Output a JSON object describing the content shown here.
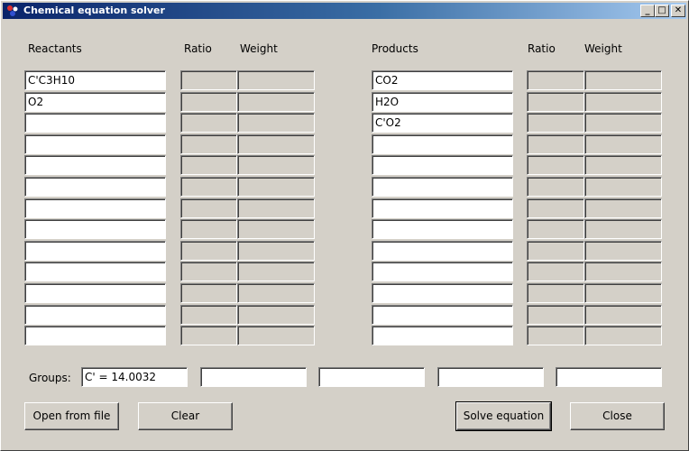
{
  "window": {
    "title": "Chemical equation solver",
    "minimize_glyph": "_",
    "maximize_glyph": "□",
    "close_glyph": "✕"
  },
  "columns": {
    "reactants": "Reactants",
    "products": "Products",
    "ratio": "Ratio",
    "weight": "Weight"
  },
  "reactants": [
    "C'C3H10",
    "O2",
    "",
    "",
    "",
    "",
    "",
    "",
    "",
    "",
    "",
    "",
    ""
  ],
  "products": [
    "CO2",
    "H2O",
    "C'O2",
    "",
    "",
    "",
    "",
    "",
    "",
    "",
    "",
    "",
    ""
  ],
  "groups": {
    "label": "Groups:",
    "values": [
      "C' = 14.0032",
      "",
      "",
      "",
      ""
    ]
  },
  "buttons": {
    "open": "Open from file",
    "clear": "Clear",
    "solve": "Solve equation",
    "close": "Close"
  }
}
